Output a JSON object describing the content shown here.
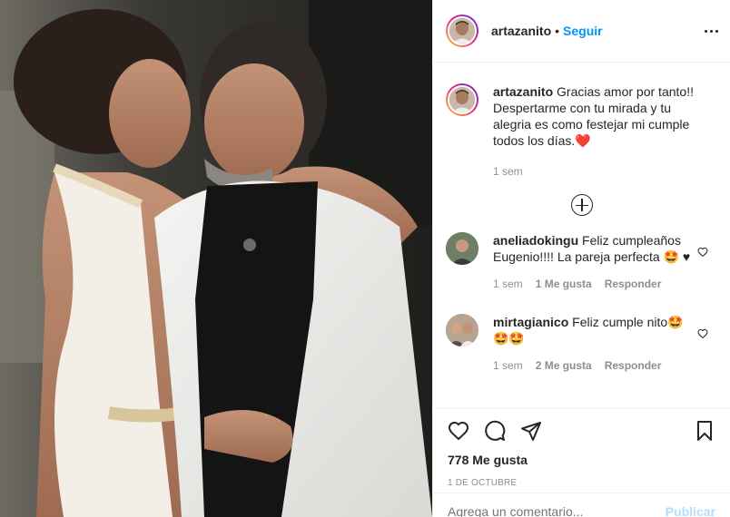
{
  "header": {
    "username": "artazanito",
    "separator": "•",
    "follow_label": "Seguir",
    "more_icon": "more-dots-icon"
  },
  "caption": {
    "username": "artazanito",
    "text": "Gracias amor por tanto!! Despertarme con tu mirada y tu alegria es como festejar mi cumple todos los días.",
    "emoji": "❤️",
    "time": "1 sem"
  },
  "load_more_icon": "plus-circle-icon",
  "comments": [
    {
      "username": "aneliadokingu",
      "text": "Feliz cumpleaños Eugenio!!!! La pareja perfecta 🤩 ♥",
      "time": "1 sem",
      "likes": "1 Me gusta",
      "reply": "Responder"
    },
    {
      "username": "mirtagianico",
      "text": "Feliz cumple nito🤩 🤩🤩",
      "time": "1 sem",
      "likes": "2 Me gusta",
      "reply": "Responder"
    }
  ],
  "actions": {
    "like_icon": "heart-icon",
    "comment_icon": "comment-icon",
    "share_icon": "share-icon",
    "save_icon": "bookmark-icon",
    "likes_text": "778 Me gusta",
    "date": "1 DE OCTUBRE"
  },
  "add_comment": {
    "placeholder": "Agrega un comentario...",
    "publish_label": "Publicar"
  },
  "colors": {
    "accent": "#0095f6",
    "text": "#262626",
    "muted": "#8e8e8e",
    "border": "#efefef"
  }
}
